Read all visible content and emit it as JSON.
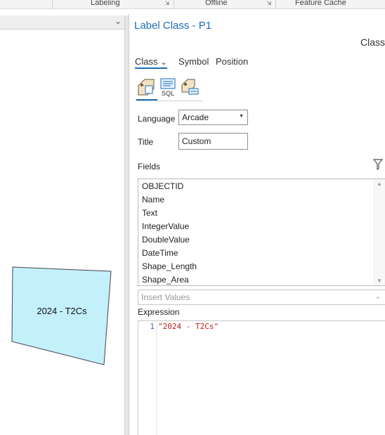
{
  "ribbon": {
    "groups": [
      {
        "label": "Labeling"
      },
      {
        "label": "Offline"
      },
      {
        "label": "Feature Cache"
      }
    ]
  },
  "map": {
    "feature_label": "2024 - T2Cs",
    "feature_fill": "#c3f0fb"
  },
  "pane": {
    "title": "Label Class - P1",
    "class_right": "Class",
    "tabs": {
      "class": "Class",
      "symbol": "Symbol",
      "position": "Position"
    },
    "icons": [
      "label-expression-icon",
      "sql-query-icon",
      "label-placement-icon"
    ],
    "sql_text": "SQL",
    "language_label": "Language",
    "language_value": "Arcade",
    "title_label": "Title",
    "title_value": "Custom",
    "fields_label": "Fields",
    "fields": [
      "OBJECTID",
      "Name",
      "Text",
      "IntegerValue",
      "DoubleValue",
      "DateTime",
      "Shape_Length",
      "Shape_Area"
    ],
    "insert_values_placeholder": "Insert Values",
    "expression_label": "Expression",
    "expression_line_number": "1",
    "expression_code": "\"2024 - T2Cs\"",
    "accent_color": "#1a6fb7"
  }
}
